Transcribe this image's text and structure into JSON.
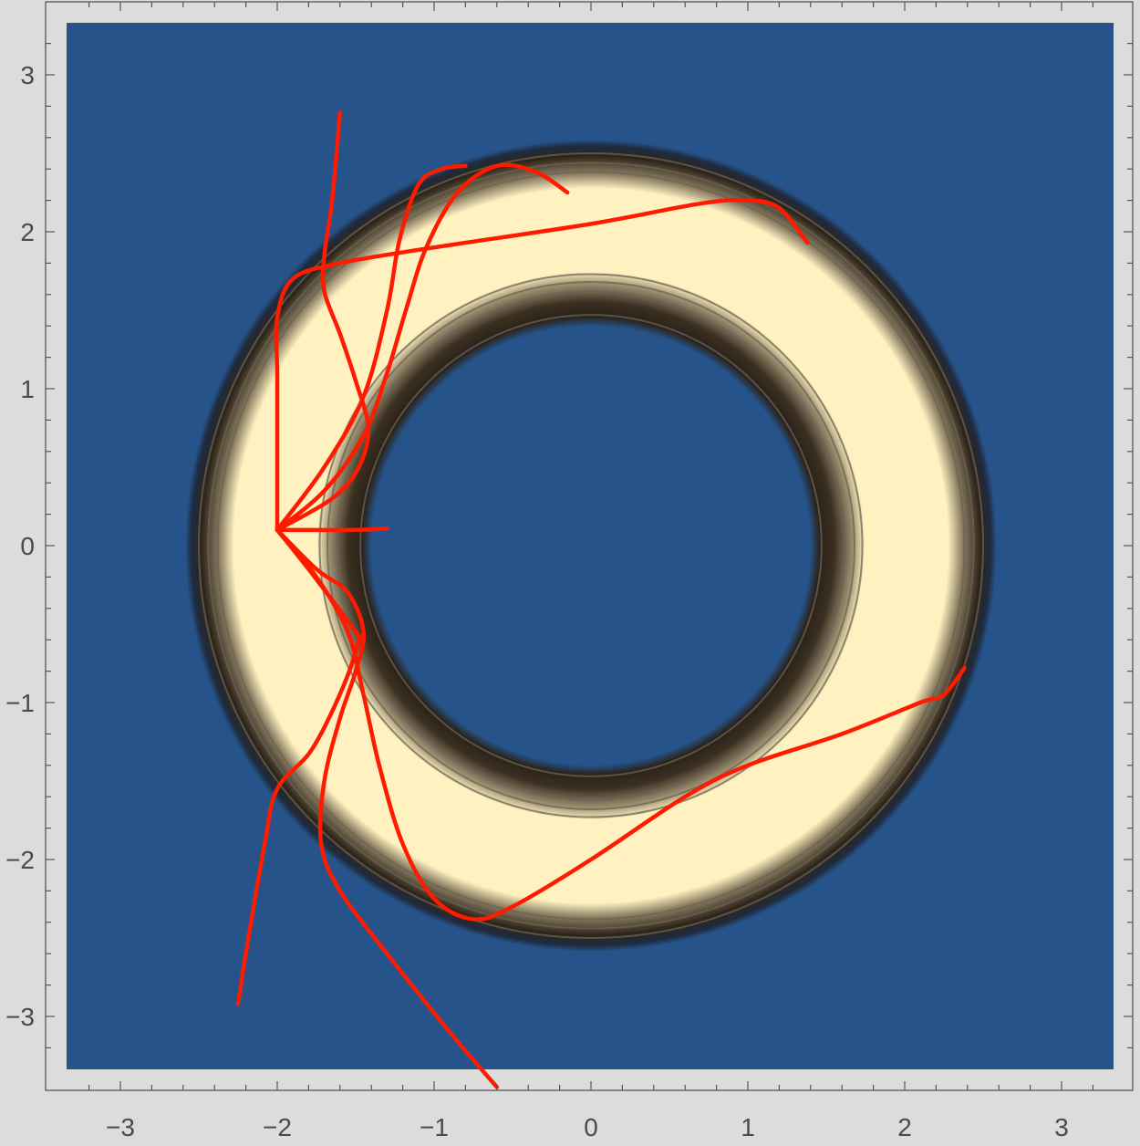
{
  "chart_data": {
    "type": "contour",
    "title": "",
    "xlabel": "",
    "ylabel": "",
    "xlim": [
      -3.35,
      3.35
    ],
    "ylim": [
      -3.35,
      3.35
    ],
    "x_ticks": [
      -3,
      -2,
      -1,
      0,
      1,
      2,
      3
    ],
    "y_ticks": [
      -3,
      -2,
      -1,
      0,
      1,
      2,
      3
    ],
    "x_tick_labels": [
      "−3",
      "−2",
      "−1",
      "0",
      "1",
      "2",
      "3"
    ],
    "y_tick_labels": [
      "−3",
      "−2",
      "−1",
      "0",
      "1",
      "2",
      "3"
    ],
    "grid": false,
    "colors": {
      "background": "#dcdcdc",
      "field_low": "#26548a",
      "ring_inner": "#fff2c0",
      "ring_dark": "#2a2118",
      "contour_line": "#6a6356",
      "trajectory": "#ff1a00",
      "axis": "#555555"
    },
    "field": {
      "description_shape": "annulus",
      "center": [
        0,
        0
      ],
      "inner_radius": 1.45,
      "outer_radius": 2.58,
      "bright_inner_radius": 1.72,
      "bright_outer_radius": 2.35
    },
    "source_point": [
      -2.0,
      0.1
    ],
    "trajectories": [
      {
        "points": [
          [
            -2.0,
            0.1
          ],
          [
            -1.5,
            0.1
          ],
          [
            -1.3,
            0.11
          ]
        ]
      },
      {
        "points": [
          [
            -2.0,
            0.1
          ],
          [
            -1.65,
            0.3
          ],
          [
            -1.48,
            0.5
          ],
          [
            -1.42,
            0.75
          ],
          [
            -1.5,
            1.05
          ],
          [
            -1.6,
            1.35
          ],
          [
            -1.7,
            1.62
          ],
          [
            -1.7,
            1.85
          ],
          [
            -1.65,
            2.2
          ],
          [
            -1.6,
            2.76
          ]
        ]
      },
      {
        "points": [
          [
            -2.0,
            0.1
          ],
          [
            -1.7,
            0.35
          ],
          [
            -1.45,
            0.7
          ],
          [
            -1.3,
            1.1
          ],
          [
            -1.18,
            1.5
          ],
          [
            -1.05,
            1.9
          ],
          [
            -0.85,
            2.25
          ],
          [
            -0.6,
            2.42
          ],
          [
            -0.35,
            2.38
          ],
          [
            -0.15,
            2.25
          ]
        ]
      },
      {
        "points": [
          [
            -2.0,
            0.1
          ],
          [
            -1.7,
            0.5
          ],
          [
            -1.45,
            0.95
          ],
          [
            -1.3,
            1.5
          ],
          [
            -1.22,
            1.95
          ],
          [
            -1.1,
            2.3
          ],
          [
            -0.95,
            2.4
          ],
          [
            -0.8,
            2.42
          ]
        ]
      },
      {
        "points": [
          [
            -2.0,
            0.1
          ],
          [
            -2.0,
            0.6
          ],
          [
            -2.0,
            1.1
          ],
          [
            -2.0,
            1.45
          ],
          [
            -1.9,
            1.7
          ],
          [
            -1.6,
            1.8
          ],
          [
            -1.0,
            1.9
          ],
          [
            0.0,
            2.05
          ],
          [
            0.7,
            2.18
          ],
          [
            1.0,
            2.2
          ],
          [
            1.2,
            2.15
          ],
          [
            1.38,
            1.93
          ]
        ]
      },
      {
        "points": [
          [
            -2.0,
            0.1
          ],
          [
            -1.75,
            -0.15
          ],
          [
            -1.55,
            -0.3
          ],
          [
            -1.45,
            -0.55
          ],
          [
            -1.5,
            -0.8
          ],
          [
            -1.6,
            -1.1
          ],
          [
            -1.7,
            -1.5
          ],
          [
            -1.72,
            -1.9
          ],
          [
            -1.6,
            -2.2
          ],
          [
            -1.3,
            -2.6
          ],
          [
            -0.9,
            -3.1
          ],
          [
            -0.6,
            -3.45
          ]
        ]
      },
      {
        "points": [
          [
            -2.0,
            0.1
          ],
          [
            -1.75,
            -0.2
          ],
          [
            -1.55,
            -0.55
          ],
          [
            -1.45,
            -0.95
          ],
          [
            -1.35,
            -1.4
          ],
          [
            -1.2,
            -1.9
          ],
          [
            -1.0,
            -2.25
          ],
          [
            -0.75,
            -2.38
          ],
          [
            -0.5,
            -2.3
          ],
          [
            0.0,
            -2.0
          ],
          [
            0.6,
            -1.6
          ],
          [
            1.0,
            -1.4
          ],
          [
            1.6,
            -1.2
          ],
          [
            2.1,
            -1.0
          ],
          [
            2.25,
            -0.95
          ],
          [
            2.38,
            -0.78
          ]
        ]
      },
      {
        "points": [
          [
            -2.0,
            0.1
          ],
          [
            -1.8,
            -0.15
          ],
          [
            -1.5,
            -0.55
          ],
          [
            -1.48,
            -0.6
          ],
          [
            -1.58,
            -0.9
          ],
          [
            -1.78,
            -1.3
          ],
          [
            -2.0,
            -1.55
          ],
          [
            -2.08,
            -1.9
          ],
          [
            -2.2,
            -2.6
          ],
          [
            -2.25,
            -2.92
          ]
        ]
      }
    ]
  }
}
